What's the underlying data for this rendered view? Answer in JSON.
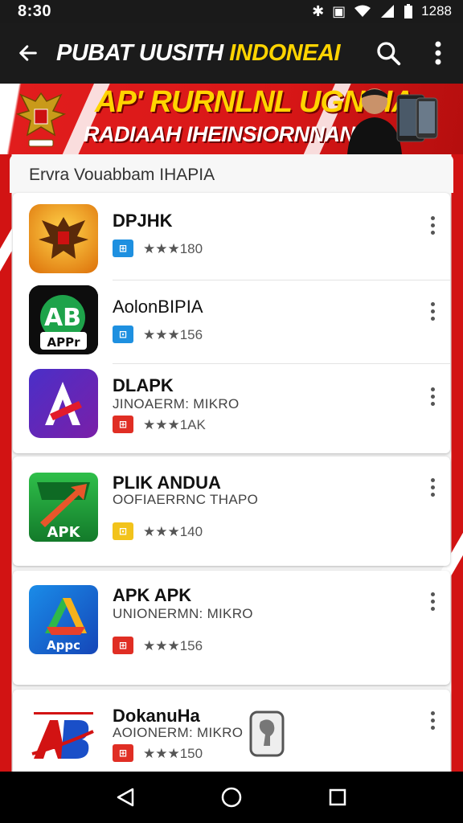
{
  "status_bar": {
    "time": "8:30",
    "battery_text": "1288"
  },
  "app_bar": {
    "title_part1": "PUBAT UUSITH ",
    "title_part2": "INDONEAI"
  },
  "banner": {
    "line1": "AP' RURNLNL UGNSIA",
    "line2": "RADIAAH IHEINSIORNNAN"
  },
  "section": {
    "header": "Ervra Vouabbam IHAPIA"
  },
  "apps": [
    {
      "name": "DPJHK",
      "subtitle": "",
      "badge": "⊞",
      "badge_color": "#1e90e0",
      "rating": "★★★180"
    },
    {
      "name": "AolonBIPIA",
      "subtitle": "",
      "badge": "⊡",
      "badge_color": "#1e90e0",
      "rating": "★★★156"
    },
    {
      "name": "DLAPK",
      "subtitle": "JINOAERM: MIKRO",
      "badge": "⊞",
      "badge_color": "#e02e24",
      "rating": "★★★1AK"
    },
    {
      "name": "PLIK ANDUA",
      "subtitle": "OOFIAERRNC THAPO",
      "badge": "⊡",
      "badge_color": "#f2c31b",
      "rating": "★★★140"
    },
    {
      "name": "APK APK",
      "subtitle": "UNIONERMN: MIKRO",
      "badge": "⊞",
      "badge_color": "#e02e24",
      "rating": "★★★156"
    },
    {
      "name": "DokanuHa",
      "subtitle": "AOIONERM: MIKRO",
      "badge": "⊞",
      "badge_color": "#e02e24",
      "rating": "★★★150"
    }
  ],
  "colors": {
    "accent_red": "#d21313",
    "accent_yellow": "#ffd400"
  }
}
